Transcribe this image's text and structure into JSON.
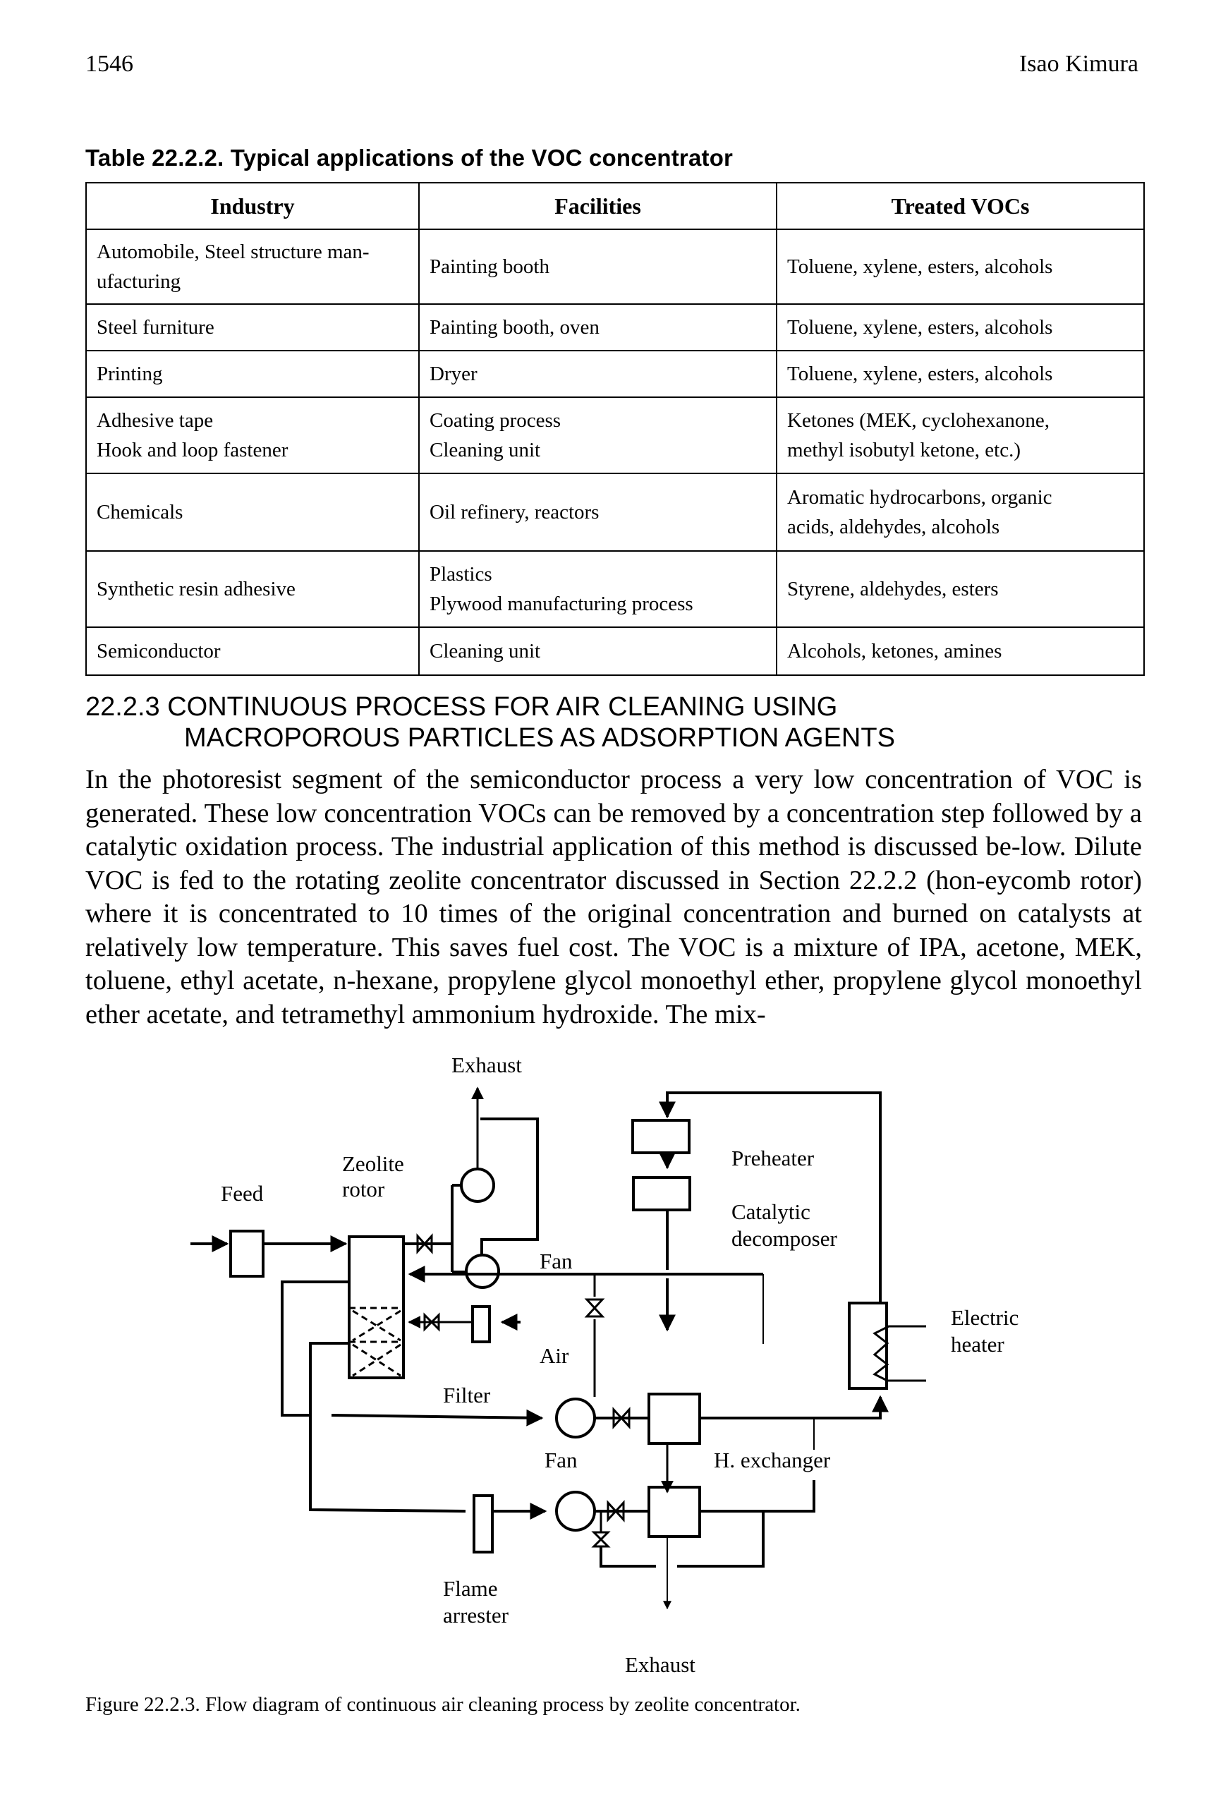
{
  "header": {
    "page_number": "1546",
    "running_head": "Isao Kimura"
  },
  "table": {
    "caption": "Table 22.2.2. Typical applications of the VOC concentrator",
    "columns": [
      "Industry",
      "Facilities",
      "Treated VOCs"
    ],
    "rows": [
      {
        "industry": [
          "Automobile, Steel  structure man-",
          "ufacturing"
        ],
        "facilities": [
          "Painting booth"
        ],
        "vocs": [
          "Toluene, xylene, esters, alcohols"
        ]
      },
      {
        "industry": [
          "Steel furniture"
        ],
        "facilities": [
          "Painting booth, oven"
        ],
        "vocs": [
          "Toluene, xylene, esters, alcohols"
        ]
      },
      {
        "industry": [
          "Printing"
        ],
        "facilities": [
          "Dryer"
        ],
        "vocs": [
          "Toluene, xylene, esters, alcohols"
        ]
      },
      {
        "industry": [
          "Adhesive tape",
          "Hook and loop fastener"
        ],
        "facilities": [
          "Coating process",
          "Cleaning unit"
        ],
        "vocs": [
          "Ketones (MEK, cyclohexanone,",
          "methyl isobutyl ketone, etc.)"
        ]
      },
      {
        "industry": [
          "Chemicals"
        ],
        "facilities": [
          "Oil refinery, reactors"
        ],
        "vocs": [
          "Aromatic hydrocarbons, organic",
          "acids, aldehydes, alcohols"
        ]
      },
      {
        "industry": [
          "Synthetic resin adhesive"
        ],
        "facilities": [
          "Plastics",
          "Plywood manufacturing process"
        ],
        "vocs": [
          "Styrene, aldehydes, esters"
        ]
      },
      {
        "industry": [
          "Semiconductor"
        ],
        "facilities": [
          "Cleaning unit"
        ],
        "vocs": [
          "Alcohols, ketones, amines"
        ]
      }
    ]
  },
  "section": {
    "heading_line1": "22.2.3 CONTINUOUS PROCESS FOR AIR CLEANING USING",
    "heading_line2": "MACROPOROUS PARTICLES AS ADSORPTION AGENTS",
    "body": "In the photoresist segment of the semiconductor process a very low concentration of VOC is generated. These low concentration VOCs can be removed by a concentration step followed by a catalytic oxidation process. The industrial application of this method is discussed be-low. Dilute VOC is fed to the rotating zeolite concentrator discussed in Section 22.2.2 (hon-eycomb rotor) where it is concentrated to 10 times of the original concentration and burned on catalysts at relatively low temperature. This saves fuel cost. The VOC is a mixture of IPA, acetone, MEK, toluene, ethyl acetate, n-hexane, propylene glycol monoethyl ether, propylene glycol monoethyl ether acetate, and tetramethyl ammonium hydroxide. The mix-"
  },
  "figure": {
    "labels": {
      "exhaust_top": "Exhaust",
      "zeolite_line1": "Zeolite",
      "zeolite_line2": "rotor",
      "feed": "Feed",
      "fan_top": "Fan",
      "preheater": "Preheater",
      "catalytic_line1": "Catalytic",
      "catalytic_line2": "decomposer",
      "electric_line1": "Electric",
      "electric_line2": "heater",
      "air": "Air",
      "filter": "Filter",
      "fan_mid": "Fan",
      "h_exchanger": "H. exchanger",
      "flame_line1": "Flame",
      "flame_line2": "arrester",
      "exhaust_bottom": "Exhaust"
    },
    "caption": "Figure 22.2.3. Flow diagram of continuous air cleaning process by zeolite concentrator."
  }
}
